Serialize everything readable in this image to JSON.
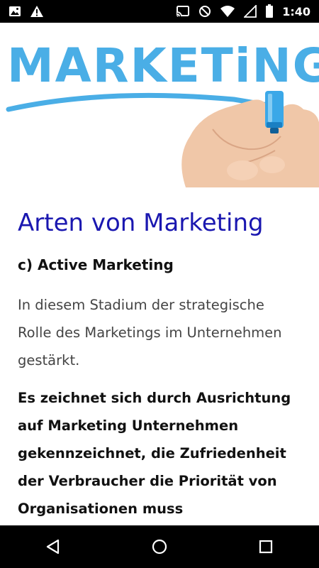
{
  "status_bar": {
    "time": "1:40",
    "left_icons": [
      "image-icon",
      "warning-icon"
    ],
    "right_icons": [
      "cast-icon",
      "do-not-disturb-icon",
      "wifi-icon",
      "signal-icon",
      "battery-icon"
    ]
  },
  "hero": {
    "word": "MARKETiNG",
    "accent_color": "#4aaee6"
  },
  "article": {
    "title": "Arten von Marketing",
    "section_heading": "c) Active Marketing",
    "paragraph": "In diesem Stadium der strategische Rolle des Marketings im Unternehmen gestärkt.",
    "paragraph_bold": "Es zeichnet sich durch Ausrichtung auf Marketing Unternehmen gekennzeichnet, die Zufriedenheit der Verbraucher die Priorität von Organisationen muss",
    "title_color": "#1a17b0"
  },
  "nav_bar": {
    "buttons": [
      "back-icon",
      "home-icon",
      "recents-icon"
    ]
  }
}
